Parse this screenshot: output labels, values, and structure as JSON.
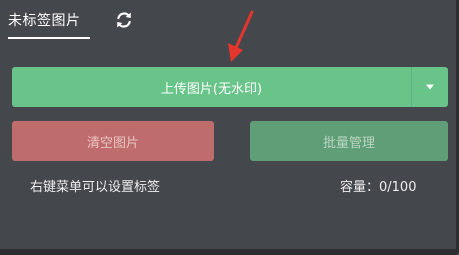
{
  "tabs": {
    "active_label": "未标签图片"
  },
  "icons": {
    "refresh": "refresh-icon",
    "arrow": "red-arrow-annotation",
    "dropdown": "caret-down-icon"
  },
  "actions": {
    "upload_label": "上传图片(无水印)",
    "clear_label": "清空图片",
    "batch_label": "批量管理"
  },
  "footer": {
    "hint": "右键菜单可以设置标签",
    "capacity": "容量：0/100"
  },
  "colors": {
    "background": "#44474c",
    "upload": "#69c48a",
    "clear": "#bf6d6c",
    "batch": "#5f9e77",
    "arrow": "#e5362d"
  }
}
